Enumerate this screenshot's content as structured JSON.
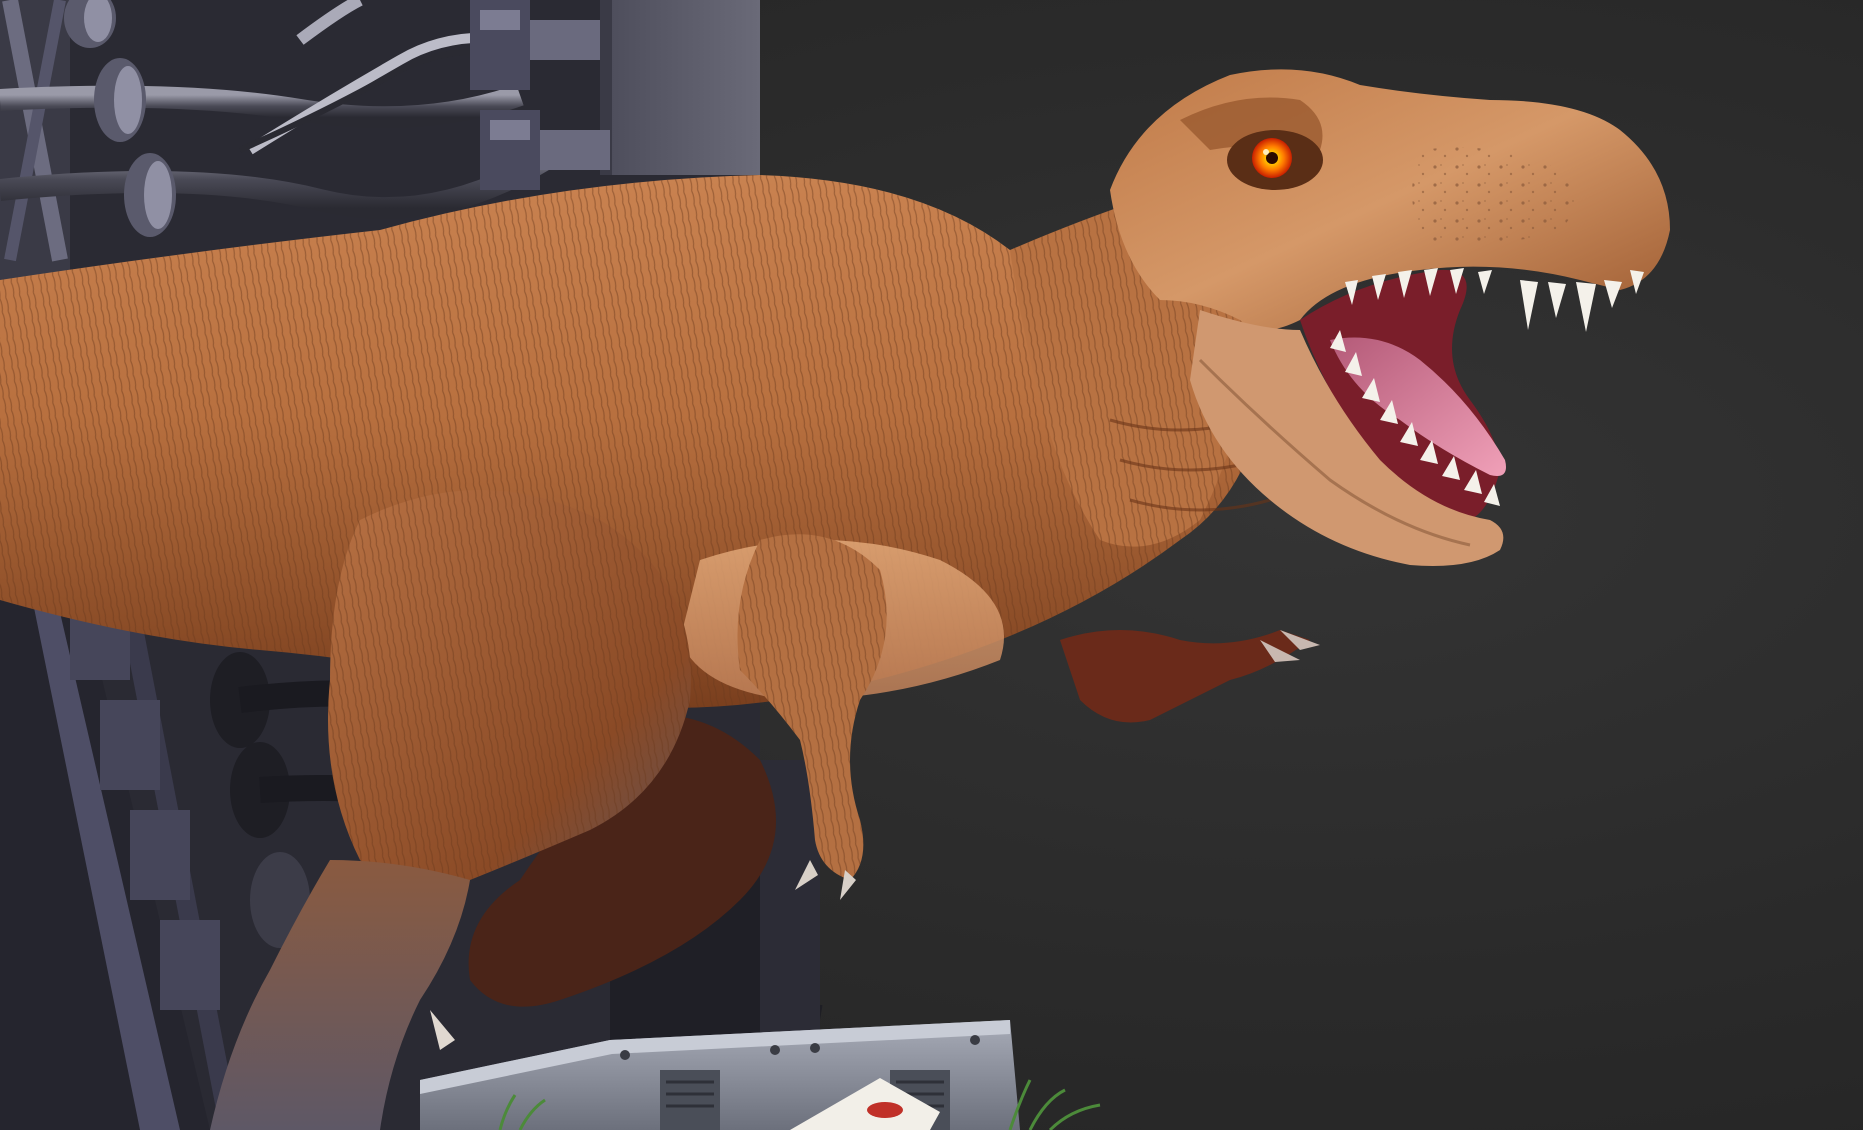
{
  "scene": {
    "subject": "tyrannosaurus-render",
    "colors": {
      "background": "#2b2b2b",
      "skin_base": "#b8703f",
      "skin_light": "#e0a070",
      "skin_shadow": "#6e3a1c",
      "belly": "#f0c8a0",
      "mouth": "#7a1e2a",
      "tongue": "#d8809a",
      "teeth": "#f4f1ea",
      "eye_outer": "#ff5a00",
      "eye_inner": "#ffd400",
      "pupil": "#2a0a00",
      "metal": "#4a4a58",
      "metal_light": "#7c7c92",
      "machine_box": "#8c909c",
      "grass": "#4c8a3a"
    }
  }
}
